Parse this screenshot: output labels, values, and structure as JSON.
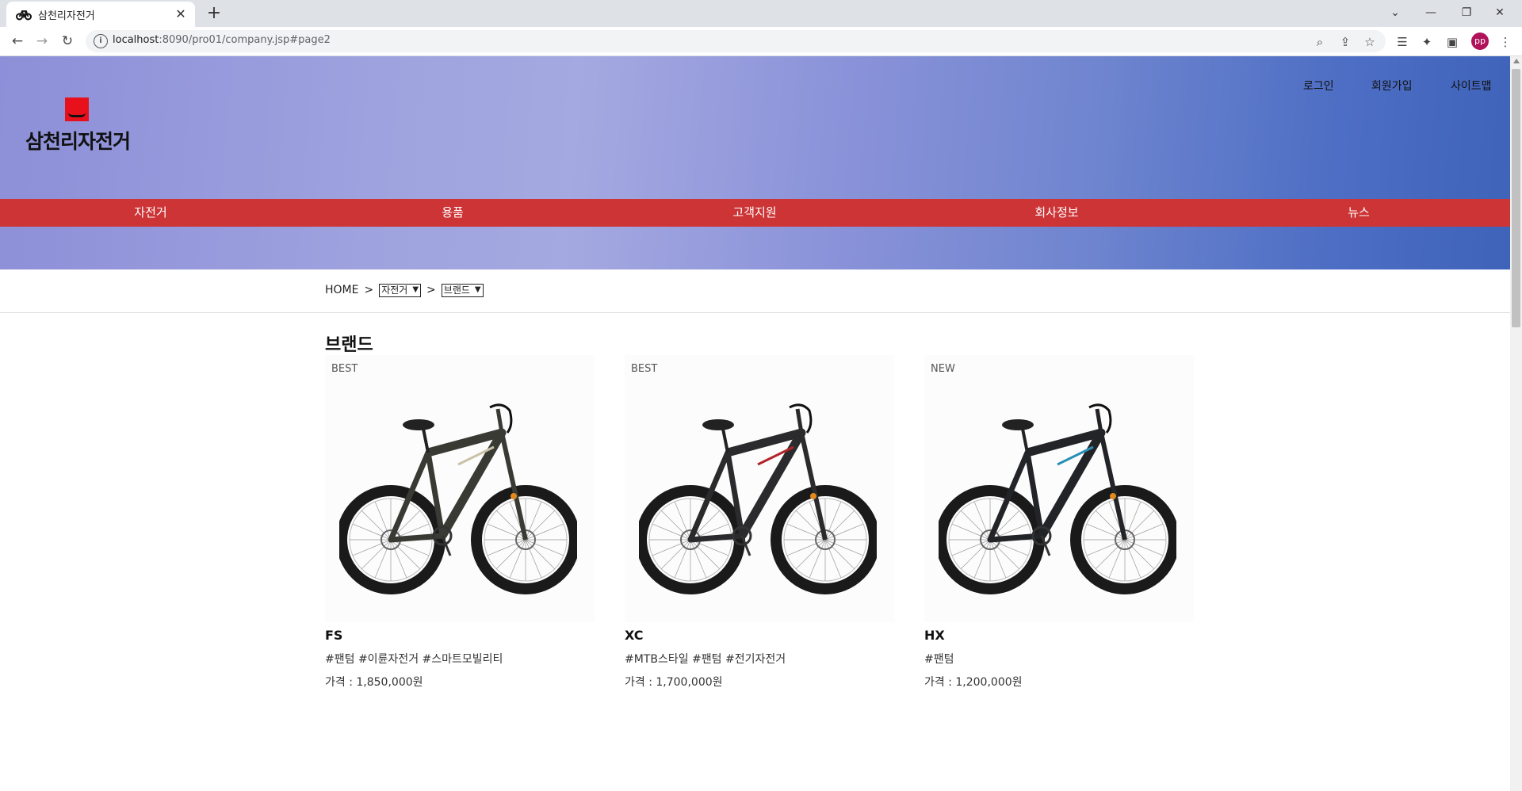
{
  "browser": {
    "tab_title": "삼천리자전거",
    "url_host": "localhost",
    "url_path": ":8090/pro01/company.jsp#page2",
    "avatar_initials": "pp"
  },
  "header": {
    "logo_text": "삼천리자전거",
    "util_links": [
      "로그인",
      "회원가입",
      "사이트맵"
    ],
    "gnb": [
      "자전거",
      "용품",
      "고객지원",
      "회사정보",
      "뉴스"
    ]
  },
  "breadcrumb": {
    "home": "HOME",
    "sep": ">",
    "select1": "자전거",
    "select2": "브랜드"
  },
  "section_title": "브랜드",
  "products": [
    {
      "badge": "BEST",
      "name": "FS",
      "tags": "#팬텀 #이륜자전거 #스마트모빌리티",
      "price": "가격 : 1,850,000원",
      "frame_color": "#3a3a35",
      "accent": "#c9c2a8"
    },
    {
      "badge": "BEST",
      "name": "XC",
      "tags": "#MTB스타일 #팬텀 #전기자전거",
      "price": "가격 : 1,700,000원",
      "frame_color": "#2b2b2d",
      "accent": "#b3222a"
    },
    {
      "badge": "NEW",
      "name": "HX",
      "tags": "#팬텀",
      "price": "가격 : 1,200,000원",
      "frame_color": "#222428",
      "accent": "#2b8fb5"
    }
  ],
  "colors": {
    "gnb_bg": "#cc3436",
    "logo_red": "#e8111b"
  }
}
